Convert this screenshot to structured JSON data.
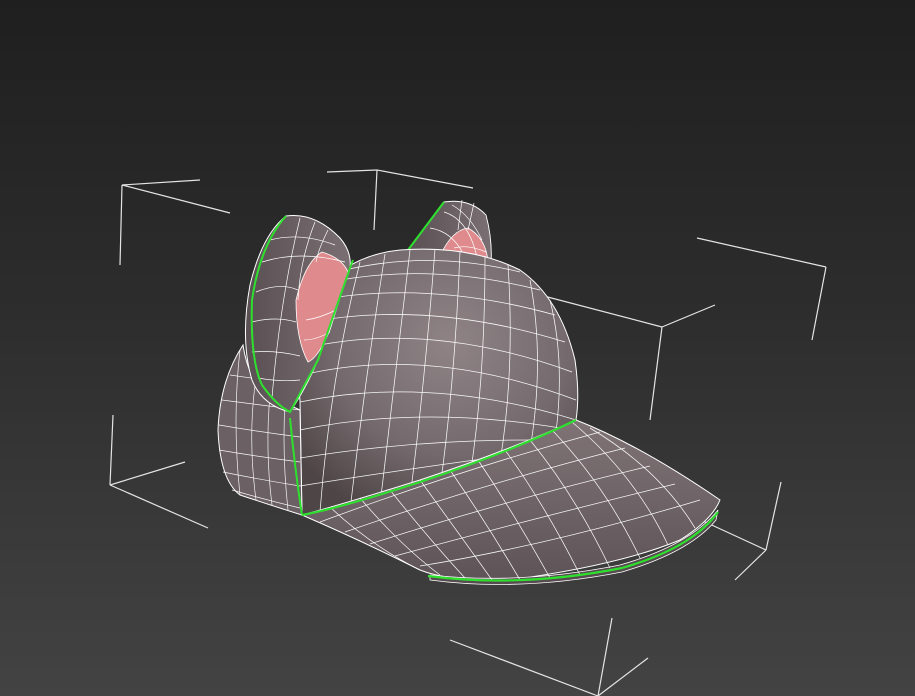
{
  "viewport": {
    "view": "perspective",
    "render_mode": "shaded-with-wireframe",
    "background_top": "#1f1f1f",
    "background_bottom": "#434343"
  },
  "object": {
    "kind": "cap-with-cat-ears-mesh",
    "selected": true,
    "colors": {
      "surface": "#7a6d70",
      "surface_light": "#8e8185",
      "surface_dark": "#5d5255",
      "inner_ear": "#df8a8c",
      "wireframe": "#ffffff",
      "selection_edges": "#2ee02e",
      "bounding_box": "#e6e6e6"
    }
  }
}
